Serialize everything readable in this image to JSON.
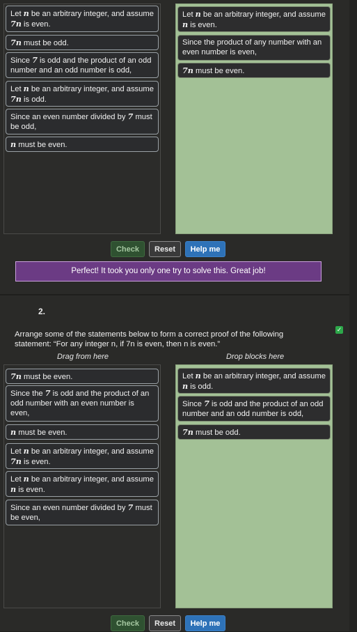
{
  "q1": {
    "left_blocks": [
      [
        "Let ",
        {
          "m": "n"
        },
        " be an arbitrary integer, and assume ",
        {
          "m": "7n"
        },
        " is even."
      ],
      [
        {
          "m": "7n"
        },
        " must be odd."
      ],
      [
        "Since ",
        {
          "m": "7"
        },
        " is odd and the product of an odd number and an odd number is odd,"
      ],
      [
        "Let ",
        {
          "m": "n"
        },
        " be an arbitrary integer, and assume ",
        {
          "m": "7n"
        },
        " is odd."
      ],
      [
        "Since an even number divided by ",
        {
          "m": "7"
        },
        " must be odd,"
      ],
      [
        {
          "m": "n"
        },
        " must be even."
      ]
    ],
    "right_blocks": [
      [
        "Let ",
        {
          "m": "n"
        },
        " be an arbitrary integer, and assume ",
        {
          "m": "n"
        },
        " is even."
      ],
      [
        "Since the product of any number with an even number is even,"
      ],
      [
        {
          "m": "7n"
        },
        " must be even."
      ]
    ],
    "buttons": {
      "check": "Check",
      "reset": "Reset",
      "help": "Help me"
    },
    "banner": "Perfect! It took you only one try to solve this. Great job!"
  },
  "q2": {
    "number": "2.",
    "prompt_parts": [
      "Arrange some of the statements below to form a correct proof of the following statement: “For any integer ",
      {
        "m": "n"
      },
      ", if ",
      {
        "m": "7n"
      },
      " is even, then ",
      {
        "m": "n"
      },
      " is even.”"
    ],
    "checkbox_icon": "✓",
    "drag_header": "Drag from here",
    "drop_header": "Drop blocks here",
    "left_blocks": [
      [
        {
          "m": "7n"
        },
        " must be even."
      ],
      [
        "Since the ",
        {
          "m": "7"
        },
        " is odd and the product of an odd number with an even number is even,"
      ],
      [
        {
          "m": "n"
        },
        " must be even."
      ],
      [
        "Let ",
        {
          "m": "n"
        },
        " be an arbitrary integer, and assume ",
        {
          "m": "7n"
        },
        " is even."
      ],
      [
        "Let ",
        {
          "m": "n"
        },
        " be an arbitrary integer, and assume ",
        {
          "m": "n"
        },
        " is even."
      ],
      [
        "Since an even number divided by ",
        {
          "m": "7"
        },
        " must be even,"
      ]
    ],
    "right_blocks": [
      [
        "Let ",
        {
          "m": "n"
        },
        " be an arbitrary integer, and assume ",
        {
          "m": "n"
        },
        " is odd."
      ],
      [
        "Since ",
        {
          "m": "7"
        },
        " is odd and the product of an odd number and an odd number is odd,"
      ],
      [
        {
          "m": "7n"
        },
        " must be odd."
      ]
    ],
    "buttons": {
      "check": "Check",
      "reset": "Reset",
      "help": "Help me"
    }
  }
}
